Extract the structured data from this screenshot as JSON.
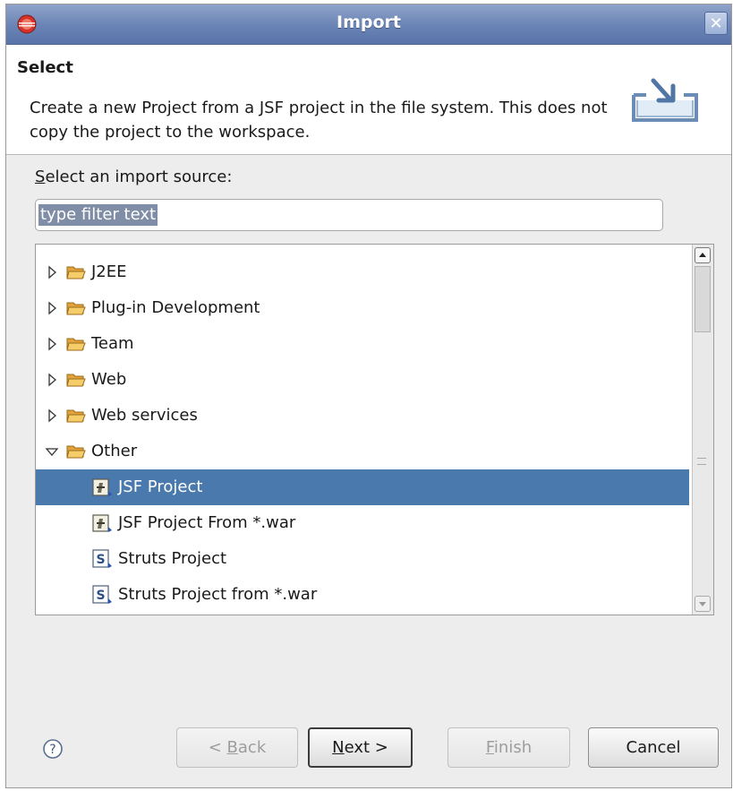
{
  "window": {
    "title": "Import",
    "close_symbol": "✕"
  },
  "header": {
    "title": "Select",
    "description": "Create a new Project from a JSF project in the file system. This does not copy the project to the workspace."
  },
  "source_label": {
    "mnemonic": "S",
    "rest": "elect an import source:"
  },
  "filter": {
    "value": "type filter text"
  },
  "tree": {
    "items": [
      {
        "label": "J2EE",
        "kind": "folder",
        "expanded": false
      },
      {
        "label": "Plug-in Development",
        "kind": "folder",
        "expanded": false
      },
      {
        "label": "Team",
        "kind": "folder",
        "expanded": false
      },
      {
        "label": "Web",
        "kind": "folder",
        "expanded": false
      },
      {
        "label": "Web services",
        "kind": "folder",
        "expanded": false
      },
      {
        "label": "Other",
        "kind": "folder",
        "expanded": true
      },
      {
        "label": "JSF Project",
        "kind": "jsf-wizard",
        "selected": true
      },
      {
        "label": "JSF Project From *.war",
        "kind": "jsf-wizard"
      },
      {
        "label": "Struts Project",
        "kind": "struts-wizard"
      },
      {
        "label": "Struts Project from *.war",
        "kind": "struts-wizard"
      }
    ]
  },
  "buttons": {
    "back": {
      "pre": "< ",
      "mnemonic": "B",
      "rest": "ack",
      "enabled": false
    },
    "next": {
      "mnemonic": "N",
      "rest": "ext >",
      "enabled": true
    },
    "finish": {
      "mnemonic": "F",
      "rest": "inish",
      "enabled": false
    },
    "cancel": {
      "label": "Cancel",
      "enabled": true
    }
  },
  "icons": {
    "app": "eclipse-icon",
    "header": "import-tray-icon",
    "help": "help-icon",
    "folder": "folder-icon",
    "jsf": "jsf-project-icon",
    "struts": "struts-project-icon"
  },
  "colors": {
    "titlebar": "#6a83b5",
    "selection": "#4a79ad",
    "folder": "#f2c14e",
    "dialog_background": "#ededed"
  }
}
